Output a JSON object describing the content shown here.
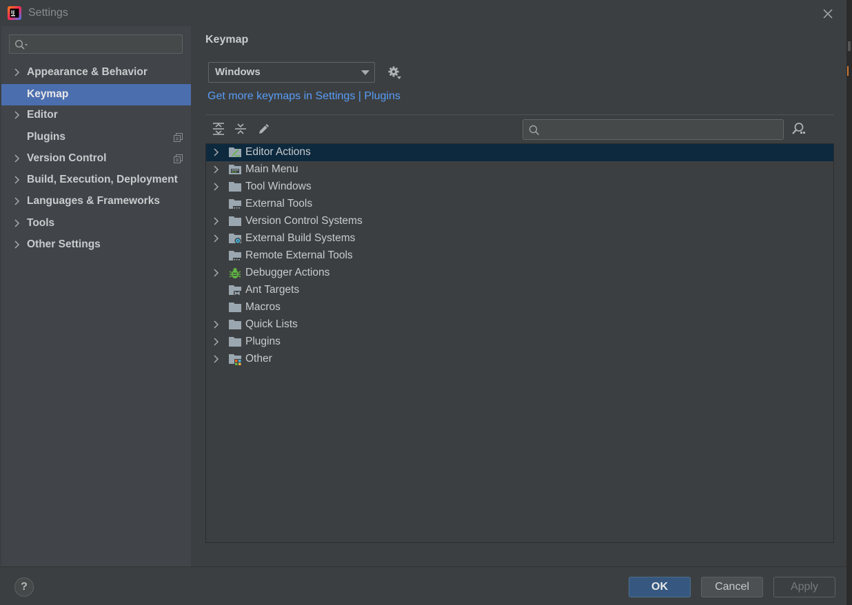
{
  "window": {
    "title": "Settings"
  },
  "sidebar": {
    "search": {
      "placeholder": ""
    },
    "items": [
      {
        "label": "Appearance & Behavior",
        "expandable": true
      },
      {
        "label": "Keymap",
        "selected": true
      },
      {
        "label": "Editor",
        "expandable": true
      },
      {
        "label": "Plugins",
        "badge": "copy-icon"
      },
      {
        "label": "Version Control",
        "expandable": true,
        "badge": "copy-icon"
      },
      {
        "label": "Build, Execution, Deployment",
        "expandable": true
      },
      {
        "label": "Languages & Frameworks",
        "expandable": true
      },
      {
        "label": "Tools",
        "expandable": true
      },
      {
        "label": "Other Settings",
        "expandable": true
      }
    ]
  },
  "main": {
    "title": "Keymap",
    "keymap_select": {
      "value": "Windows"
    },
    "more_link": "Get more keymaps in Settings | Plugins",
    "search": {
      "placeholder": ""
    },
    "tree": [
      {
        "label": "Editor Actions",
        "expandable": true,
        "icon": "editor-actions-icon",
        "selected": true
      },
      {
        "label": "Main Menu",
        "expandable": true,
        "icon": "main-menu-folder-icon"
      },
      {
        "label": "Tool Windows",
        "expandable": true,
        "icon": "folder-icon"
      },
      {
        "label": "External Tools",
        "expandable": false,
        "icon": "external-tools-folder-icon"
      },
      {
        "label": "Version Control Systems",
        "expandable": true,
        "icon": "folder-icon"
      },
      {
        "label": "External Build Systems",
        "expandable": true,
        "icon": "build-systems-folder-icon"
      },
      {
        "label": "Remote External Tools",
        "expandable": false,
        "icon": "external-tools-folder-icon"
      },
      {
        "label": "Debugger Actions",
        "expandable": true,
        "icon": "debugger-bug-icon"
      },
      {
        "label": "Ant Targets",
        "expandable": false,
        "icon": "ant-targets-folder-icon"
      },
      {
        "label": "Macros",
        "expandable": false,
        "icon": "folder-icon"
      },
      {
        "label": "Quick Lists",
        "expandable": true,
        "icon": "folder-icon"
      },
      {
        "label": "Plugins",
        "expandable": true,
        "icon": "folder-icon"
      },
      {
        "label": "Other",
        "expandable": true,
        "icon": "other-folder-icon"
      }
    ]
  },
  "footer": {
    "help": "?",
    "ok": "OK",
    "cancel": "Cancel",
    "apply": "Apply"
  },
  "colors": {
    "background": "#3c3f41",
    "sidebar": "#414549",
    "selection": "#4b6eaf",
    "tree_selection": "#0d293e",
    "link": "#589df6",
    "primary_button": "#365880"
  }
}
